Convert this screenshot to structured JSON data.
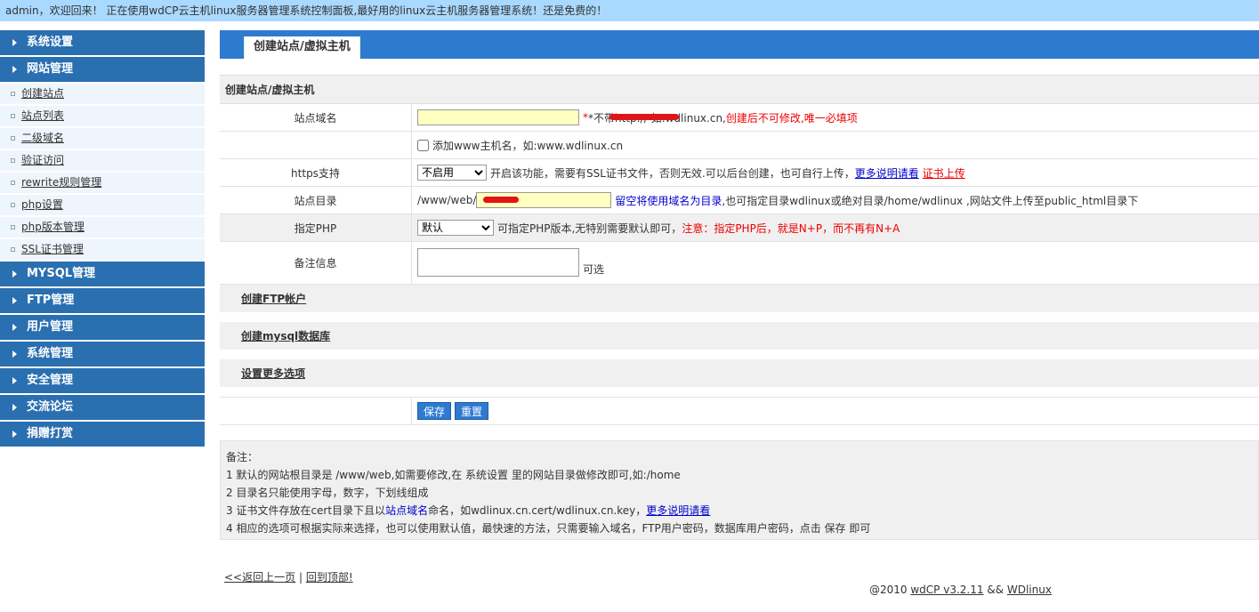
{
  "topbar": {
    "text": "admin，欢迎回来！ 正在使用wdCP云主机linux服务器管理系统控制面板,最好用的linux云主机服务器管理系统！还是免费的！"
  },
  "sidebar": {
    "system_settings": "系统设置",
    "site_management": "网站管理",
    "sub_items": [
      "创建站点",
      "站点列表",
      "二级域名",
      "验证访问",
      "rewrite规则管理",
      "php设置",
      "php版本管理",
      "SSL证书管理"
    ],
    "mysql": "MYSQL管理",
    "ftp": "FTP管理",
    "user": "用户管理",
    "system_mgmt": "系统管理",
    "security": "安全管理",
    "forum": "交流论坛",
    "donate": "捐赠打赏"
  },
  "main": {
    "tab": "创建站点/虚拟主机",
    "section_title": "创建站点/虚拟主机",
    "domain": {
      "label": "站点域名",
      "hint_prefix": "*不带http:// 如:wdlinux.cn,",
      "hint_red": "创建后不可修改,唯一必填项"
    },
    "www": {
      "label": "添加www主机名，如:www.wdlinux.cn"
    },
    "https": {
      "label": "https支持",
      "selected": "不启用",
      "hint": "开启该功能，需要有SSL证书文件，否则无效.可以后台创建，也可自行上传，",
      "more_link": "更多说明请看",
      "upload_link": "证书上传"
    },
    "dir": {
      "label": "站点目录",
      "prefix": "/www/web/",
      "hint_blue": "留空将使用域名为目录",
      "hint": ",也可指定目录wdlinux或绝对目录/home/wdlinux ,网站文件上传至public_html目录下"
    },
    "php": {
      "label": "指定PHP",
      "selected": "默认",
      "hint": "可指定PHP版本,无特别需要默认即可，",
      "hint_red": "注意：指定PHP后，就是N+P，而不再有N+A"
    },
    "remark": {
      "label": "备注信息",
      "optional": "可选"
    },
    "ftp_link": "创建FTP帐户",
    "mysql_link": "创建mysql数据库",
    "more_options": "设置更多选项",
    "save_btn": "保存",
    "reset_btn": "重置"
  },
  "notes": {
    "title": "备注：",
    "line1": "1 默认的网站根目录是 /www/web,如需要修改,在 系统设置 里的网站目录做修改即可,如:/home",
    "line2": "2 目录名只能使用字母，数字，下划线组成",
    "line3_prefix": "3 证书文件存放在cert目录下且以",
    "line3_blue": "站点域名",
    "line3_mid": "命名，如wdlinux.cn.cert/wdlinux.cn.key，",
    "line3_link": "更多说明请看",
    "line4": "4 相应的选项可根据实际来选择，也可以使用默认值，最快速的方法，只需要输入域名，FTP用户密码，数据库用户密码，点击 保存 即可"
  },
  "bottom": {
    "back": "<<返回上一页",
    "sep": "|",
    "top": "回到顶部!"
  },
  "footer": {
    "copy": "@2010 ",
    "version": "wdCP v3.2.11",
    "and": " && ",
    "brand": "WDlinux"
  }
}
